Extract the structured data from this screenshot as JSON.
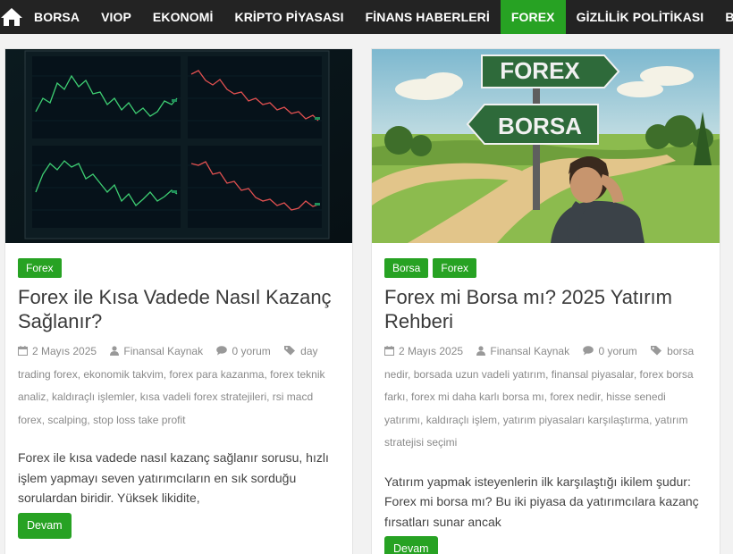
{
  "nav": {
    "items": [
      {
        "label": "BORSA"
      },
      {
        "label": "VIOP"
      },
      {
        "label": "EKONOMİ"
      },
      {
        "label": "KRİPTO PİYASASI"
      },
      {
        "label": "FİNANS HABERLERİ"
      },
      {
        "label": "FOREX",
        "active": true
      },
      {
        "label": "GİZLİLİK POLİTİKASI"
      },
      {
        "label": "BİZE"
      }
    ],
    "home_icon": "home-icon"
  },
  "colors": {
    "nav_bg": "#232323",
    "accent": "#27a223"
  },
  "posts": [
    {
      "image_alt": "trading chart screens",
      "categories": [
        "Forex"
      ],
      "title": "Forex ile Kısa Vadede Nasıl Kazanç Sağlanır?",
      "date": "2 Mayıs 2025",
      "author": "Finansal Kaynak",
      "comments": "0 yorum",
      "tags": [
        "day trading forex",
        "ekonomik takvim",
        "forex para kazanma",
        "forex teknik analiz",
        "kaldıraçlı işlemler",
        "kısa vadeli forex stratejileri",
        "rsi macd forex",
        "scalping",
        "stop loss take profit"
      ],
      "excerpt": "Forex ile kısa vadede nasıl kazanç sağlanır sorusu, hızlı işlem yapmayı seven yatırımcıların en sık sorduğu sorulardan biridir. Yüksek likidite,",
      "more": "Devam"
    },
    {
      "image_alt": "crossroads sign FOREX BORSA",
      "sign_top": "FOREX",
      "sign_bottom": "BORSA",
      "categories": [
        "Borsa",
        "Forex"
      ],
      "title": "Forex mi Borsa mı? 2025 Yatırım Rehberi",
      "date": "2 Mayıs 2025",
      "author": "Finansal Kaynak",
      "comments": "0 yorum",
      "tags": [
        "borsa nedir",
        "borsada uzun vadeli yatırım",
        "finansal piyasalar",
        "forex borsa farkı",
        "forex mi daha karlı borsa mı",
        "forex nedir",
        "hisse senedi yatırımı",
        "kaldıraçlı işlem",
        "yatırım piyasaları karşılaştırma",
        "yatırım stratejisi seçimi"
      ],
      "excerpt": "Yatırım yapmak isteyenlerin ilk karşılaştığı ikilem şudur: Forex mi borsa mı? Bu iki piyasa da yatırımcılara kazanç fırsatları sunar ancak",
      "more": "Devam"
    }
  ]
}
